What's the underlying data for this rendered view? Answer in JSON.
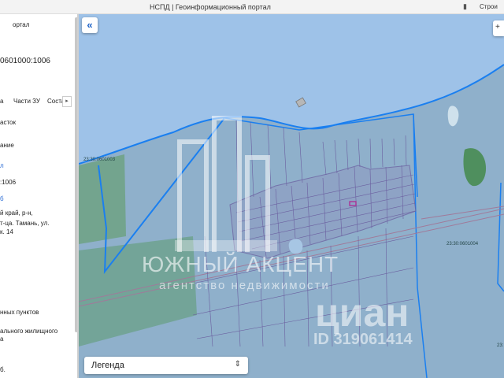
{
  "browser": {
    "title": "НСПД | Геоинформационный портал",
    "bookmark_label": "Строи"
  },
  "sidebar": {
    "portal": "ортал",
    "number": "0601000:1006",
    "tabs": [
      "а",
      "Части ЗУ",
      "Соста"
    ],
    "tab_more": "▸",
    "rows": [
      "асток",
      "ание",
      ":1006",
      "й край, р-н,",
      "т-ца. Тамань, ул.",
      "к. 14",
      "нных пунктов",
      "ального жилищного",
      "а",
      "б."
    ],
    "blue_marks": [
      "л",
      "б"
    ]
  },
  "map": {
    "parcel_labels": [
      "23:30:0601003",
      "23:30:0601004",
      "23:"
    ],
    "collapse_icon": "«",
    "zoom_icon": "+",
    "colors": {
      "sea": "#9fc3e9",
      "land": "#8fb1cc",
      "boundary": "#1a7ff0",
      "green": "#5d9a70",
      "parcel_line": "#6b5fa0"
    }
  },
  "legend": {
    "label": "Легенда",
    "chevron": "⌃⌄"
  },
  "watermark": {
    "line1": "ЮЖНЫЙ АКЦЕНТ",
    "line2": "агентство недвижимости",
    "cian": "циан",
    "id": "ID 319061414"
  }
}
